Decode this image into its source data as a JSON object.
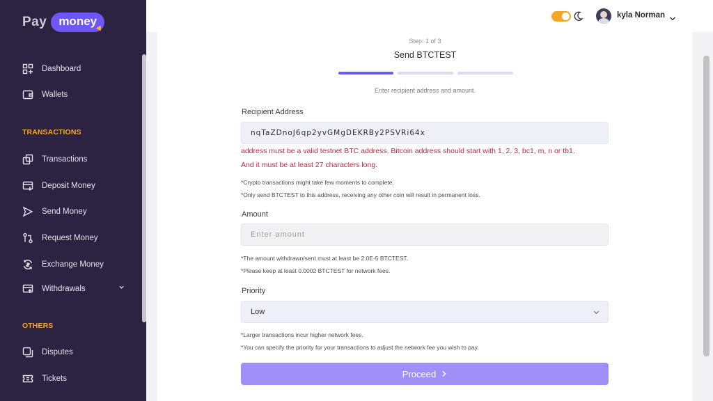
{
  "brand": {
    "part1": "Pay",
    "part2": "money"
  },
  "sidebar": {
    "items_top": [
      {
        "label": "Dashboard",
        "icon": "dashboard-icon"
      },
      {
        "label": "Wallets",
        "icon": "wallet-icon"
      }
    ],
    "section_transactions": "TRANSACTIONS",
    "items_transactions": [
      {
        "label": "Transactions",
        "icon": "transactions-icon"
      },
      {
        "label": "Deposit Money",
        "icon": "deposit-icon"
      },
      {
        "label": "Send Money",
        "icon": "send-icon"
      },
      {
        "label": "Request Money",
        "icon": "request-icon"
      },
      {
        "label": "Exchange Money",
        "icon": "exchange-icon"
      },
      {
        "label": "Withdrawals",
        "icon": "withdrawals-icon"
      }
    ],
    "section_others": "OTHERS",
    "items_others": [
      {
        "label": "Disputes",
        "icon": "disputes-icon"
      },
      {
        "label": "Tickets",
        "icon": "tickets-icon"
      }
    ]
  },
  "header": {
    "username": "kyla Norman"
  },
  "form": {
    "step": "Step: 1 of 3",
    "title": "Send BTCTEST",
    "subtitle": "Enter recipient address and amount.",
    "recipient_label": "Recipient Address",
    "recipient_value": "nqTaZDnoJ6qp2yvGMgDEKRBy2PSVRi64x",
    "error_line1": "address must be a valid testnet BTC address. Bitcoin address should start with 1, 2, 3, bc1, m, n or tb1.",
    "error_line2": "And it must be at least 27 characters long.",
    "note1": "*Crypto transactions might take few moments to complete.",
    "note2": "*Only send BTCTEST to this address, receiving any other coin will result in permanent loss.",
    "amount_label": "Amount",
    "amount_placeholder": "Enter amount",
    "note3": "*The amount withdrawn/sent must at least be 2.0E-5 BTCTEST.",
    "note4": "*Please keep at least 0.0002 BTCTEST for network fees.",
    "priority_label": "Priority",
    "priority_value": "Low",
    "note5": "*Larger transactions incur higher network fees.",
    "note6": "*You can specify the priority for your transactions to adjust the network fee you wish to pay.",
    "proceed_label": "Proceed"
  },
  "colors": {
    "sidebar_bg": "#2c2241",
    "accent": "#6e5cf0",
    "section": "#f5a623",
    "error": "#d0203f",
    "button": "#a08ff6"
  }
}
